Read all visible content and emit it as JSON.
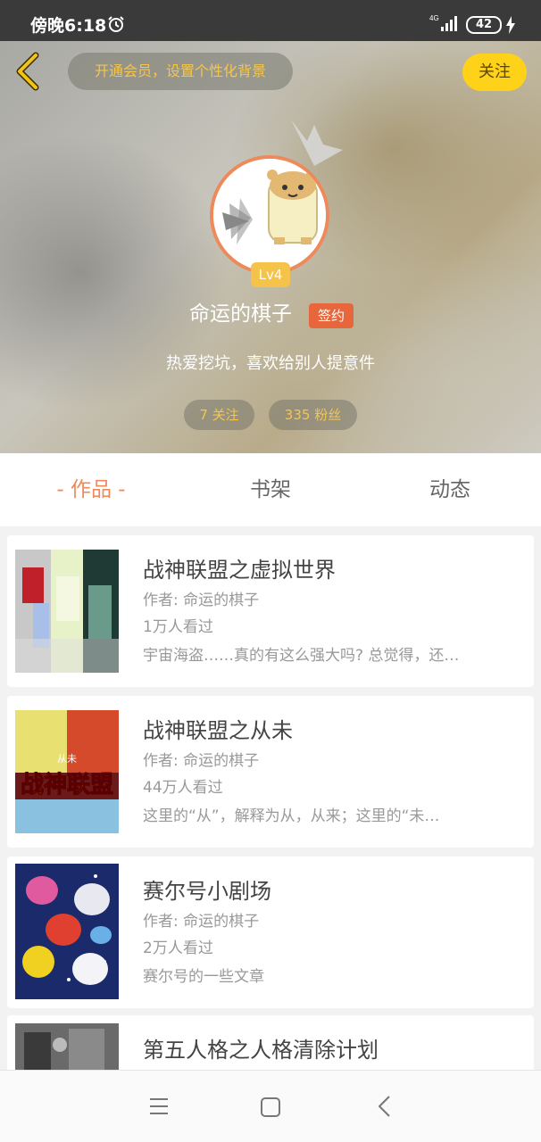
{
  "status_bar": {
    "time": "傍晚6:18",
    "network": "4G",
    "battery": "42"
  },
  "header": {
    "vip_prompt": "开通会员，设置个性化背景",
    "follow_label": "关注",
    "level": "Lv4",
    "nickname": "命运的棋子",
    "sign_badge": "签约",
    "bio": "热爱挖坑，喜欢给别人提意件",
    "following": "7 关注",
    "fans": "335 粉丝"
  },
  "tabs": [
    {
      "label": "- 作品 -",
      "active": true
    },
    {
      "label": "书架",
      "active": false
    },
    {
      "label": "动态",
      "active": false
    }
  ],
  "books": [
    {
      "title": "战神联盟之虚拟世界",
      "author": "作者: 命运的棋子",
      "views": "1万人看过",
      "desc": "宇宙海盗……真的有这么强大吗? 总觉得，还…"
    },
    {
      "title": "战神联盟之从未",
      "author": "作者: 命运的棋子",
      "views": "44万人看过",
      "desc": "这里的“从”，解释为从，从来；这里的“未…",
      "cover_text": "战神联盟",
      "cover_small": "从未"
    },
    {
      "title": "赛尔号小剧场",
      "author": "作者: 命运的棋子",
      "views": "2万人看过",
      "desc": "赛尔号的一些文章"
    },
    {
      "title": "第五人格之人格清除计划",
      "author": "",
      "views": "",
      "desc": ""
    }
  ],
  "colors": {
    "accent": "#ef8a5a",
    "follow_button": "#ffd21a",
    "sign_badge": "#e8663c",
    "level_badge": "#f6c34a"
  },
  "icons": {
    "back": "chevron-left-icon",
    "alarm": "alarm-clock-icon",
    "crown": "crown-icon",
    "nav_menu": "menu-icon",
    "nav_home": "home-square-icon",
    "nav_back": "back-triangle-icon"
  }
}
